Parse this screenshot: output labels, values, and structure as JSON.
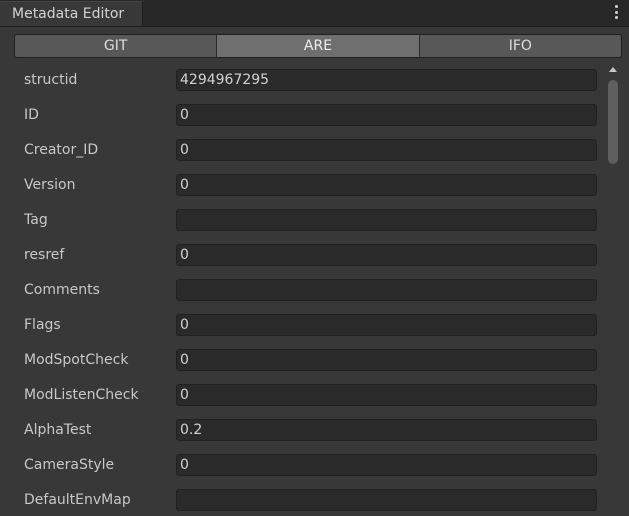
{
  "window": {
    "tab_title": "Metadata Editor",
    "menu_icon": "kebab-menu-icon"
  },
  "tabs": [
    {
      "label": "GIT",
      "active": false
    },
    {
      "label": "ARE",
      "active": true
    },
    {
      "label": "IFO",
      "active": false
    }
  ],
  "fields": [
    {
      "label": "structid",
      "value": "4294967295"
    },
    {
      "label": "ID",
      "value": "0"
    },
    {
      "label": "Creator_ID",
      "value": "0"
    },
    {
      "label": "Version",
      "value": "0"
    },
    {
      "label": "Tag",
      "value": ""
    },
    {
      "label": "resref",
      "value": "0"
    },
    {
      "label": "Comments",
      "value": ""
    },
    {
      "label": "Flags",
      "value": "0"
    },
    {
      "label": "ModSpotCheck",
      "value": "0"
    },
    {
      "label": "ModListenCheck",
      "value": "0"
    },
    {
      "label": "AlphaTest",
      "value": "0.2"
    },
    {
      "label": "CameraStyle",
      "value": "0"
    },
    {
      "label": "DefaultEnvMap",
      "value": ""
    }
  ],
  "colors": {
    "background": "#383838",
    "field_background": "#2a2a2a",
    "segment": "#585858",
    "segment_active": "#6f6f6f",
    "text": "#c8c8c8"
  }
}
